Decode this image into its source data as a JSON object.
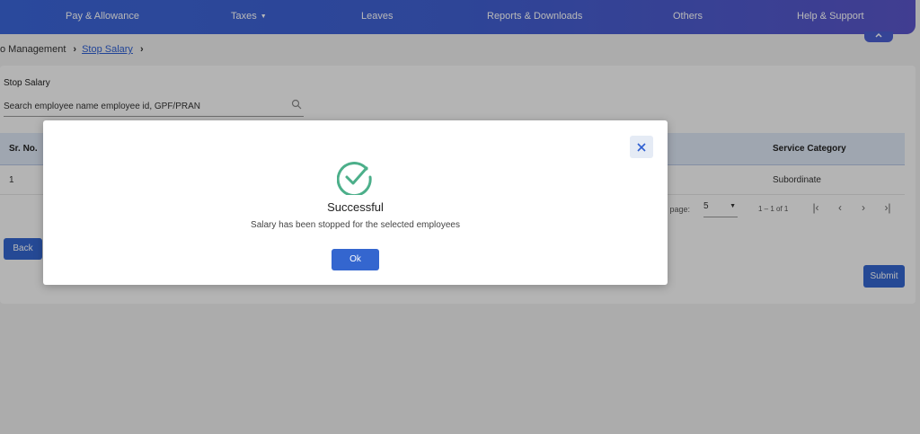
{
  "nav": {
    "items": [
      {
        "label": "Pay & Allowance"
      },
      {
        "label": "Taxes"
      },
      {
        "label": "Leaves"
      },
      {
        "label": "Reports & Downloads"
      },
      {
        "label": "Others"
      },
      {
        "label": "Help & Support"
      }
    ],
    "collapse_icon": "chevron-up-icon"
  },
  "breadcrumb": {
    "parent": "o Management",
    "current": "Stop Salary"
  },
  "page": {
    "title": "Stop Salary",
    "search": {
      "placeholder": "Search employee name employee id, GPF/PRAN",
      "value": ""
    }
  },
  "table": {
    "columns": [
      "Sr. No.",
      "Service Category"
    ],
    "rows": [
      {
        "sr": "1",
        "service_category": "Subordinate"
      }
    ]
  },
  "pager": {
    "items_per_page_label": "er page:",
    "page_size": "5",
    "range": "1 – 1 of 1"
  },
  "buttons": {
    "back": "Back",
    "submit": "Submit"
  },
  "modal": {
    "title": "Successful",
    "message": "Salary has been stopped for the selected employees",
    "ok": "Ok",
    "icon": "check-circle-icon",
    "close_icon": "close-icon"
  },
  "colors": {
    "accent": "#3466cf",
    "nav_start": "#3b66d8",
    "nav_end": "#5a55c9",
    "success": "#4caf8a"
  }
}
